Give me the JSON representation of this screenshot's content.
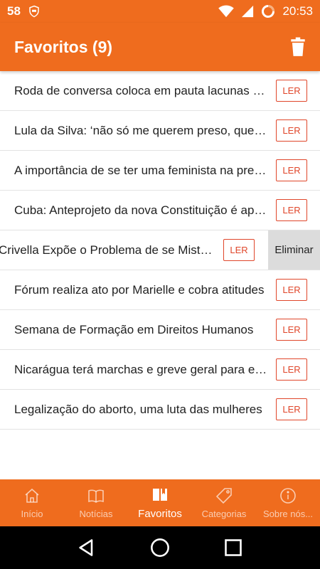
{
  "status_bar": {
    "left_number": "58",
    "time": "20:53"
  },
  "app_bar": {
    "title": "Favoritos (9)"
  },
  "articles": [
    {
      "title": "Roda de conversa coloca em pauta lacunas do trabalho",
      "button": "LER"
    },
    {
      "title": "Lula da Silva: ‘não só me querem preso, querem-me morto’",
      "button": "LER"
    },
    {
      "title": "A importância de se ter uma feminista na presidência",
      "button": "LER"
    },
    {
      "title": "Cuba: Anteprojeto da nova Constituição é aprovado",
      "button": "LER"
    },
    {
      "title": "Crivella Expõe o Problema de se Misturar Religião",
      "button": "LER",
      "swipe_action": "Eliminar"
    },
    {
      "title": "Fórum realiza ato por Marielle e cobra atitudes",
      "button": "LER"
    },
    {
      "title": "Semana de Formação em Direitos Humanos",
      "button": "LER"
    },
    {
      "title": "Nicarágua terá marchas e greve geral para exigir",
      "button": "LER"
    },
    {
      "title": "Legalização do aborto, uma luta das mulheres",
      "button": "LER"
    }
  ],
  "bottom_nav": [
    {
      "label": "Início",
      "icon": "home-icon",
      "active": false
    },
    {
      "label": "Notícias",
      "icon": "book-icon",
      "active": false
    },
    {
      "label": "Favoritos",
      "icon": "bookmark-book-icon",
      "active": true
    },
    {
      "label": "Categorias",
      "icon": "tag-icon",
      "active": false
    },
    {
      "label": "Sobre nós...",
      "icon": "info-icon",
      "active": false
    }
  ],
  "colors": {
    "primary": "#ef6c1e",
    "accent": "#e0462a"
  }
}
